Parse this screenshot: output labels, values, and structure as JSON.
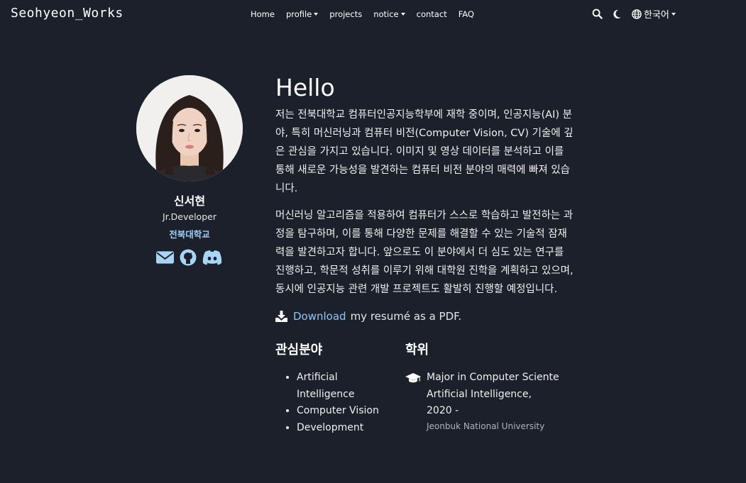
{
  "nav": {
    "brand": "Seohyeon_Works",
    "items": [
      {
        "label": "Home"
      },
      {
        "label": "profile"
      },
      {
        "label": "projects"
      },
      {
        "label": "notice"
      },
      {
        "label": "contact"
      },
      {
        "label": "FAQ"
      }
    ],
    "language": "한국어"
  },
  "profile": {
    "name": "신서현",
    "role": "Jr.Developer",
    "school": "전북대학교"
  },
  "main": {
    "greeting": "Hello",
    "paragraphs": [
      "저는 전북대학교 컴퓨터인공지능학부에 재학 중이며, 인공지능(AI) 분야, 특히 머신러닝과 컴퓨터 비전(Computer Vision, CV) 기술에 깊은 관심을 가지고 있습니다. 이미지 및 영상 데이터를 분석하고 이를 통해 새로운 가능성을 발견하는 컴퓨터 비전 분야의 매력에 빠져 있습니다.",
      "머신러닝 알고리즘을 적용하여 컴퓨터가 스스로 학습하고 발전하는 과정을 탐구하며, 이를 통해 다양한 문제를 해결할 수 있는 기술적 잠재력을 발견하고자 합니다. 앞으로도 이 분야에서 더 심도 있는 연구를 진행하고, 학문적 성취를 이루기 위해 대학원 진학을 계획하고 있으며, 동시에 인공지능 관련 개발 프로젝트도 활발히 진행할 예정입니다."
    ],
    "download_link": "Download",
    "download_rest": "my resumé as a PDF.",
    "interests_title": "관심분야",
    "interests": [
      "Artificial Intelligence",
      "Computer Vision",
      "Development"
    ],
    "education_title": "학위",
    "degree_line1": "Major in Computer Sciente",
    "degree_line2": "Artificial Intelligence,",
    "degree_year": "2020 -",
    "university": "Jeonbuk National University"
  },
  "colors": {
    "background": "#1c202b",
    "link": "#8ec7f3",
    "icon": "#a8d4f5"
  },
  "icons": [
    "search-icon",
    "moon-icon",
    "globe-icon",
    "envelope-icon",
    "github-icon",
    "discord-icon",
    "download-icon",
    "graduation-cap-icon"
  ]
}
